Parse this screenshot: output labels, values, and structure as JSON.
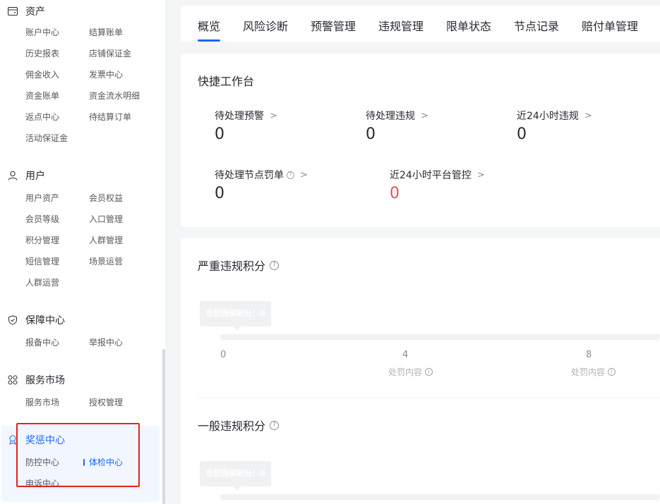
{
  "sidebar": {
    "groups": [
      {
        "title": "资产",
        "icon": "wallet-icon",
        "items": [
          "账户中心",
          "结算账单",
          "历史报表",
          "店铺保证金",
          "佣金收入",
          "发票中心",
          "资金账单",
          "资金流水明细",
          "返点中心",
          "待结算订单",
          "活动保证金"
        ]
      },
      {
        "title": "用户",
        "icon": "user-icon",
        "items": [
          "用户资产",
          "会员权益",
          "会员等级",
          "入口管理",
          "积分管理",
          "人群管理",
          "短信管理",
          "场景运营",
          "人群运营"
        ]
      },
      {
        "title": "保障中心",
        "icon": "shield-icon",
        "items": [
          "报备中心",
          "举报中心"
        ]
      },
      {
        "title": "服务市场",
        "icon": "apps-icon",
        "items": [
          "服务市场",
          "授权管理"
        ]
      },
      {
        "title": "奖惩中心",
        "icon": "award-icon",
        "items": [
          "防控中心",
          "体检中心",
          "申诉中心"
        ]
      }
    ]
  },
  "tabs": [
    "概览",
    "风险诊断",
    "预警管理",
    "违规管理",
    "限单状态",
    "节点记录",
    "赔付单管理"
  ],
  "quick": {
    "title": "快捷工作台",
    "stats": [
      {
        "label": "待处理预警",
        "value": "0"
      },
      {
        "label": "待处理违规",
        "value": "0"
      },
      {
        "label": "近24小时违规",
        "value": "0"
      },
      {
        "label": "待处理节点罚单",
        "value": "0"
      },
      {
        "label": "近24小时平台管控",
        "value": "0"
      }
    ]
  },
  "serious": {
    "title": "严重违规积分",
    "tooltip": "当前违规积分：0",
    "ticks": [
      "0",
      "4",
      "8"
    ],
    "tick_sub": "处罚内容"
  },
  "general": {
    "title": "一般违规积分",
    "tooltip": "当前违规积分：0"
  },
  "colors": {
    "accent": "#1966ff",
    "danger": "#f24a5c",
    "highlight": "#e8201c"
  }
}
